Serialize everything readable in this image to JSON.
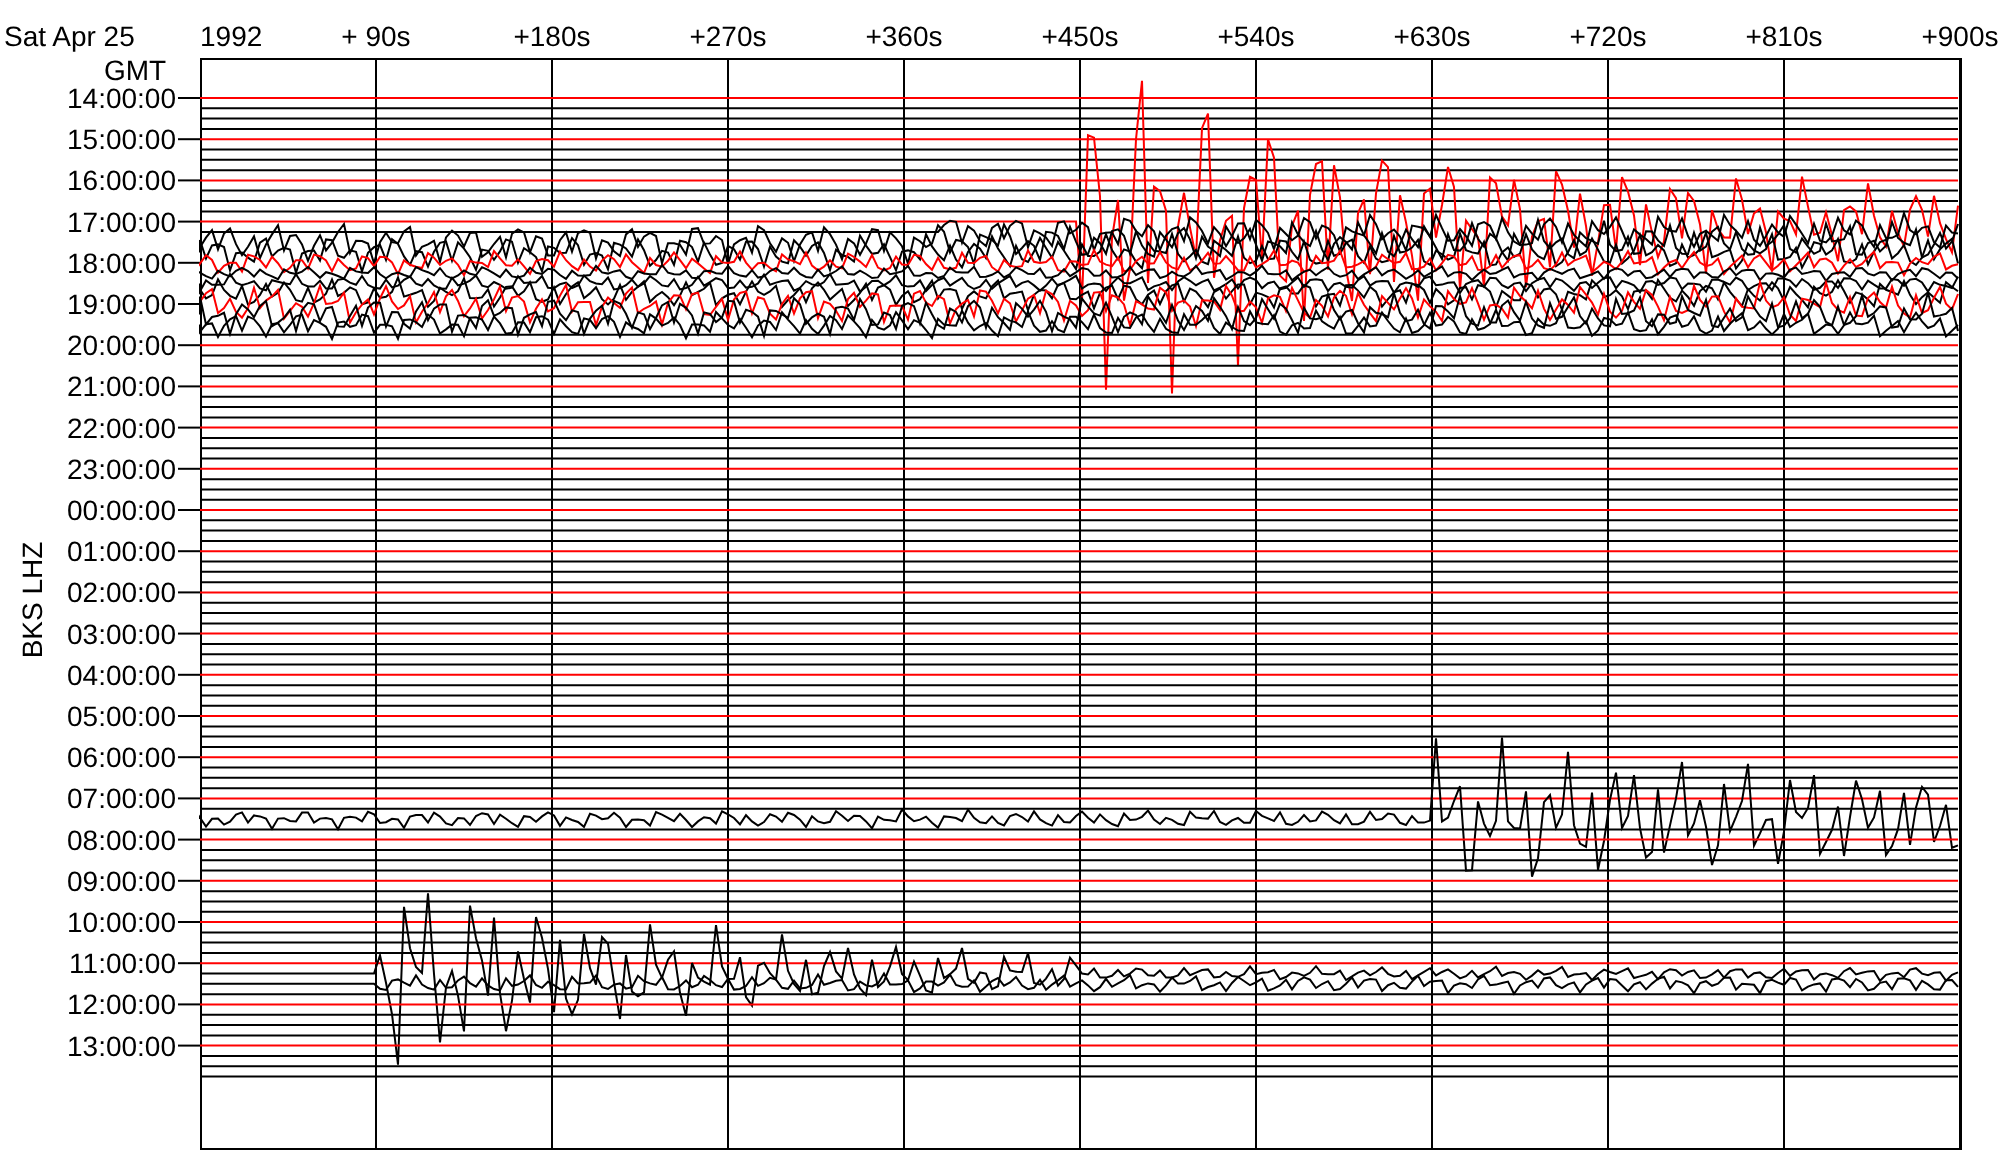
{
  "header": {
    "date": "Sat Apr 25",
    "year": "1992",
    "timezone": "GMT"
  },
  "station": "BKS LHZ",
  "x_ticks": [
    "+ 90s",
    "+180s",
    "+270s",
    "+360s",
    "+450s",
    "+540s",
    "+630s",
    "+720s",
    "+810s",
    "+900s"
  ],
  "hour_labels": [
    "14:00:00",
    "15:00:00",
    "16:00:00",
    "17:00:00",
    "18:00:00",
    "19:00:00",
    "20:00:00",
    "21:00:00",
    "22:00:00",
    "23:00:00",
    "00:00:00",
    "01:00:00",
    "02:00:00",
    "03:00:00",
    "04:00:00",
    "05:00:00",
    "06:00:00",
    "07:00:00",
    "08:00:00",
    "09:00:00",
    "10:00:00",
    "11:00:00",
    "12:00:00",
    "13:00:00"
  ]
}
